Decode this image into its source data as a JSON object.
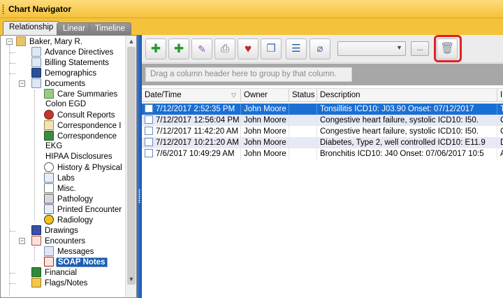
{
  "window": {
    "title": "Chart Navigator"
  },
  "tabs": [
    {
      "label": "Relationship",
      "active": true
    },
    {
      "label": "Linear",
      "active": false
    },
    {
      "label": "Timeline",
      "active": false
    }
  ],
  "tree": {
    "patient": "Baker, Mary R.",
    "items": [
      {
        "label": "Advance Directives",
        "icon": "document-icon"
      },
      {
        "label": "Billing Statements",
        "icon": "document-icon"
      },
      {
        "label": "Demographics",
        "icon": "person-card-icon"
      },
      {
        "label": "Documents",
        "icon": "documents-icon"
      },
      {
        "label": "Care Summaries",
        "icon": "care-summary-icon"
      },
      {
        "label": "Colon EGD",
        "icon": "none"
      },
      {
        "label": "Consult Reports",
        "icon": "consult-icon"
      },
      {
        "label": "Correspondence I",
        "icon": "envelope-icon"
      },
      {
        "label": "Correspondence",
        "icon": "envelope-icon"
      },
      {
        "label": "EKG",
        "icon": "none"
      },
      {
        "label": "HIPAA Disclosures",
        "icon": "none"
      },
      {
        "label": "History & Physical",
        "icon": "stethoscope-icon"
      },
      {
        "label": "Labs",
        "icon": "flask-icon"
      },
      {
        "label": "Misc.",
        "icon": "page-icon"
      },
      {
        "label": "Pathology",
        "icon": "microscope-icon"
      },
      {
        "label": "Printed Encounter",
        "icon": "printer-icon"
      },
      {
        "label": "Radiology",
        "icon": "radiation-icon"
      },
      {
        "label": "Drawings",
        "icon": "hand-icon"
      },
      {
        "label": "Encounters",
        "icon": "encounters-icon"
      },
      {
        "label": "Messages",
        "icon": "message-icon"
      },
      {
        "label": "SOAP Notes",
        "icon": "soap-notes-icon"
      },
      {
        "label": "Financial",
        "icon": "dollar-icon"
      },
      {
        "label": "Flags/Notes",
        "icon": "flag-icon"
      }
    ]
  },
  "toolbar": {
    "select_value": "",
    "ellipsis_label": "..."
  },
  "group_hint": "Drag a column header here to group by that column.",
  "grid": {
    "columns": [
      "Date/Time",
      "Owner",
      "Status",
      "Description",
      "I"
    ],
    "rows": [
      {
        "datetime": "7/12/2017 2:52:35 PM",
        "owner": "John Moore",
        "status": "",
        "description": "Tonsillitis    ICD10:  J03.90  Onset:  07/12/2017",
        "extra": "T"
      },
      {
        "datetime": "7/12/2017 12:56:04 PM",
        "owner": "John Moore",
        "status": "",
        "description": "Congestive heart failure, systolic    ICD10:  I50.",
        "extra": "C"
      },
      {
        "datetime": "7/12/2017 11:42:20 AM",
        "owner": "John Moore",
        "status": "",
        "description": "Congestive heart failure, systolic    ICD10:  I50.",
        "extra": "C"
      },
      {
        "datetime": "7/12/2017 10:21:20 AM",
        "owner": "John Moore",
        "status": "",
        "description": "Diabetes, Type 2, well controlled    ICD10:  E11.9",
        "extra": "D"
      },
      {
        "datetime": "7/6/2017 10:49:29 AM",
        "owner": "John Moore",
        "status": "",
        "description": "Bronchitis    ICD10:  J40  Onset:  07/06/2017 10:5",
        "extra": "A"
      }
    ]
  },
  "colors": {
    "title_bar": "#f5c23c",
    "selected_row": "#1a6fd4",
    "highlight_border": "#e02222"
  }
}
